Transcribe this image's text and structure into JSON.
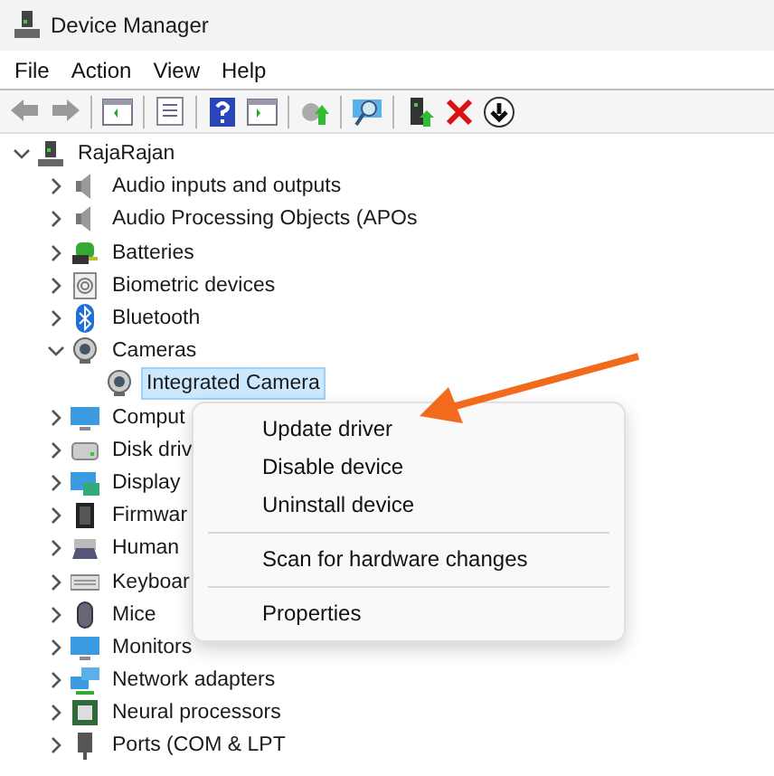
{
  "window": {
    "title": "Device Manager"
  },
  "menu_bar": [
    "File",
    "Action",
    "View",
    "Help"
  ],
  "tree": [
    {
      "label": "RajaRajan",
      "expanded": true,
      "selected": false,
      "children": [
        {
          "label": "Audio inputs and outputs",
          "expanded": false,
          "selected": false
        },
        {
          "label": "Audio Processing Objects (APOs",
          "expanded": false,
          "selected": false
        },
        {
          "label": "Batteries",
          "expanded": false,
          "selected": false
        },
        {
          "label": "Biometric devices",
          "expanded": false,
          "selected": false
        },
        {
          "label": "Bluetooth",
          "expanded": false,
          "selected": false
        },
        {
          "label": "Cameras",
          "expanded": true,
          "selected": false,
          "children": [
            {
              "label": "Integrated Camera",
              "selected": true
            }
          ]
        },
        {
          "label": "Comput",
          "expanded": false,
          "selected": false
        },
        {
          "label": "Disk driv",
          "expanded": false,
          "selected": false
        },
        {
          "label": "Display",
          "expanded": false,
          "selected": false
        },
        {
          "label": "Firmwar",
          "expanded": false,
          "selected": false
        },
        {
          "label": "Human",
          "expanded": false,
          "selected": false
        },
        {
          "label": "Keyboar",
          "expanded": false,
          "selected": false
        },
        {
          "label": "Mice",
          "expanded": false,
          "selected": false
        },
        {
          "label": "Monitors",
          "expanded": false,
          "selected": false
        },
        {
          "label": "Network adapters",
          "expanded": false,
          "selected": false
        },
        {
          "label": "Neural processors",
          "expanded": false,
          "selected": false
        },
        {
          "label": "Ports (COM & LPT",
          "expanded": false,
          "selected": false
        }
      ]
    }
  ],
  "context_menu": [
    {
      "kind": "item",
      "label": "Update driver"
    },
    {
      "kind": "item",
      "label": "Disable device"
    },
    {
      "kind": "item",
      "label": "Uninstall device"
    },
    {
      "kind": "separator"
    },
    {
      "kind": "item",
      "label": "Scan for hardware changes"
    },
    {
      "kind": "separator"
    },
    {
      "kind": "item",
      "label": "Properties"
    }
  ]
}
